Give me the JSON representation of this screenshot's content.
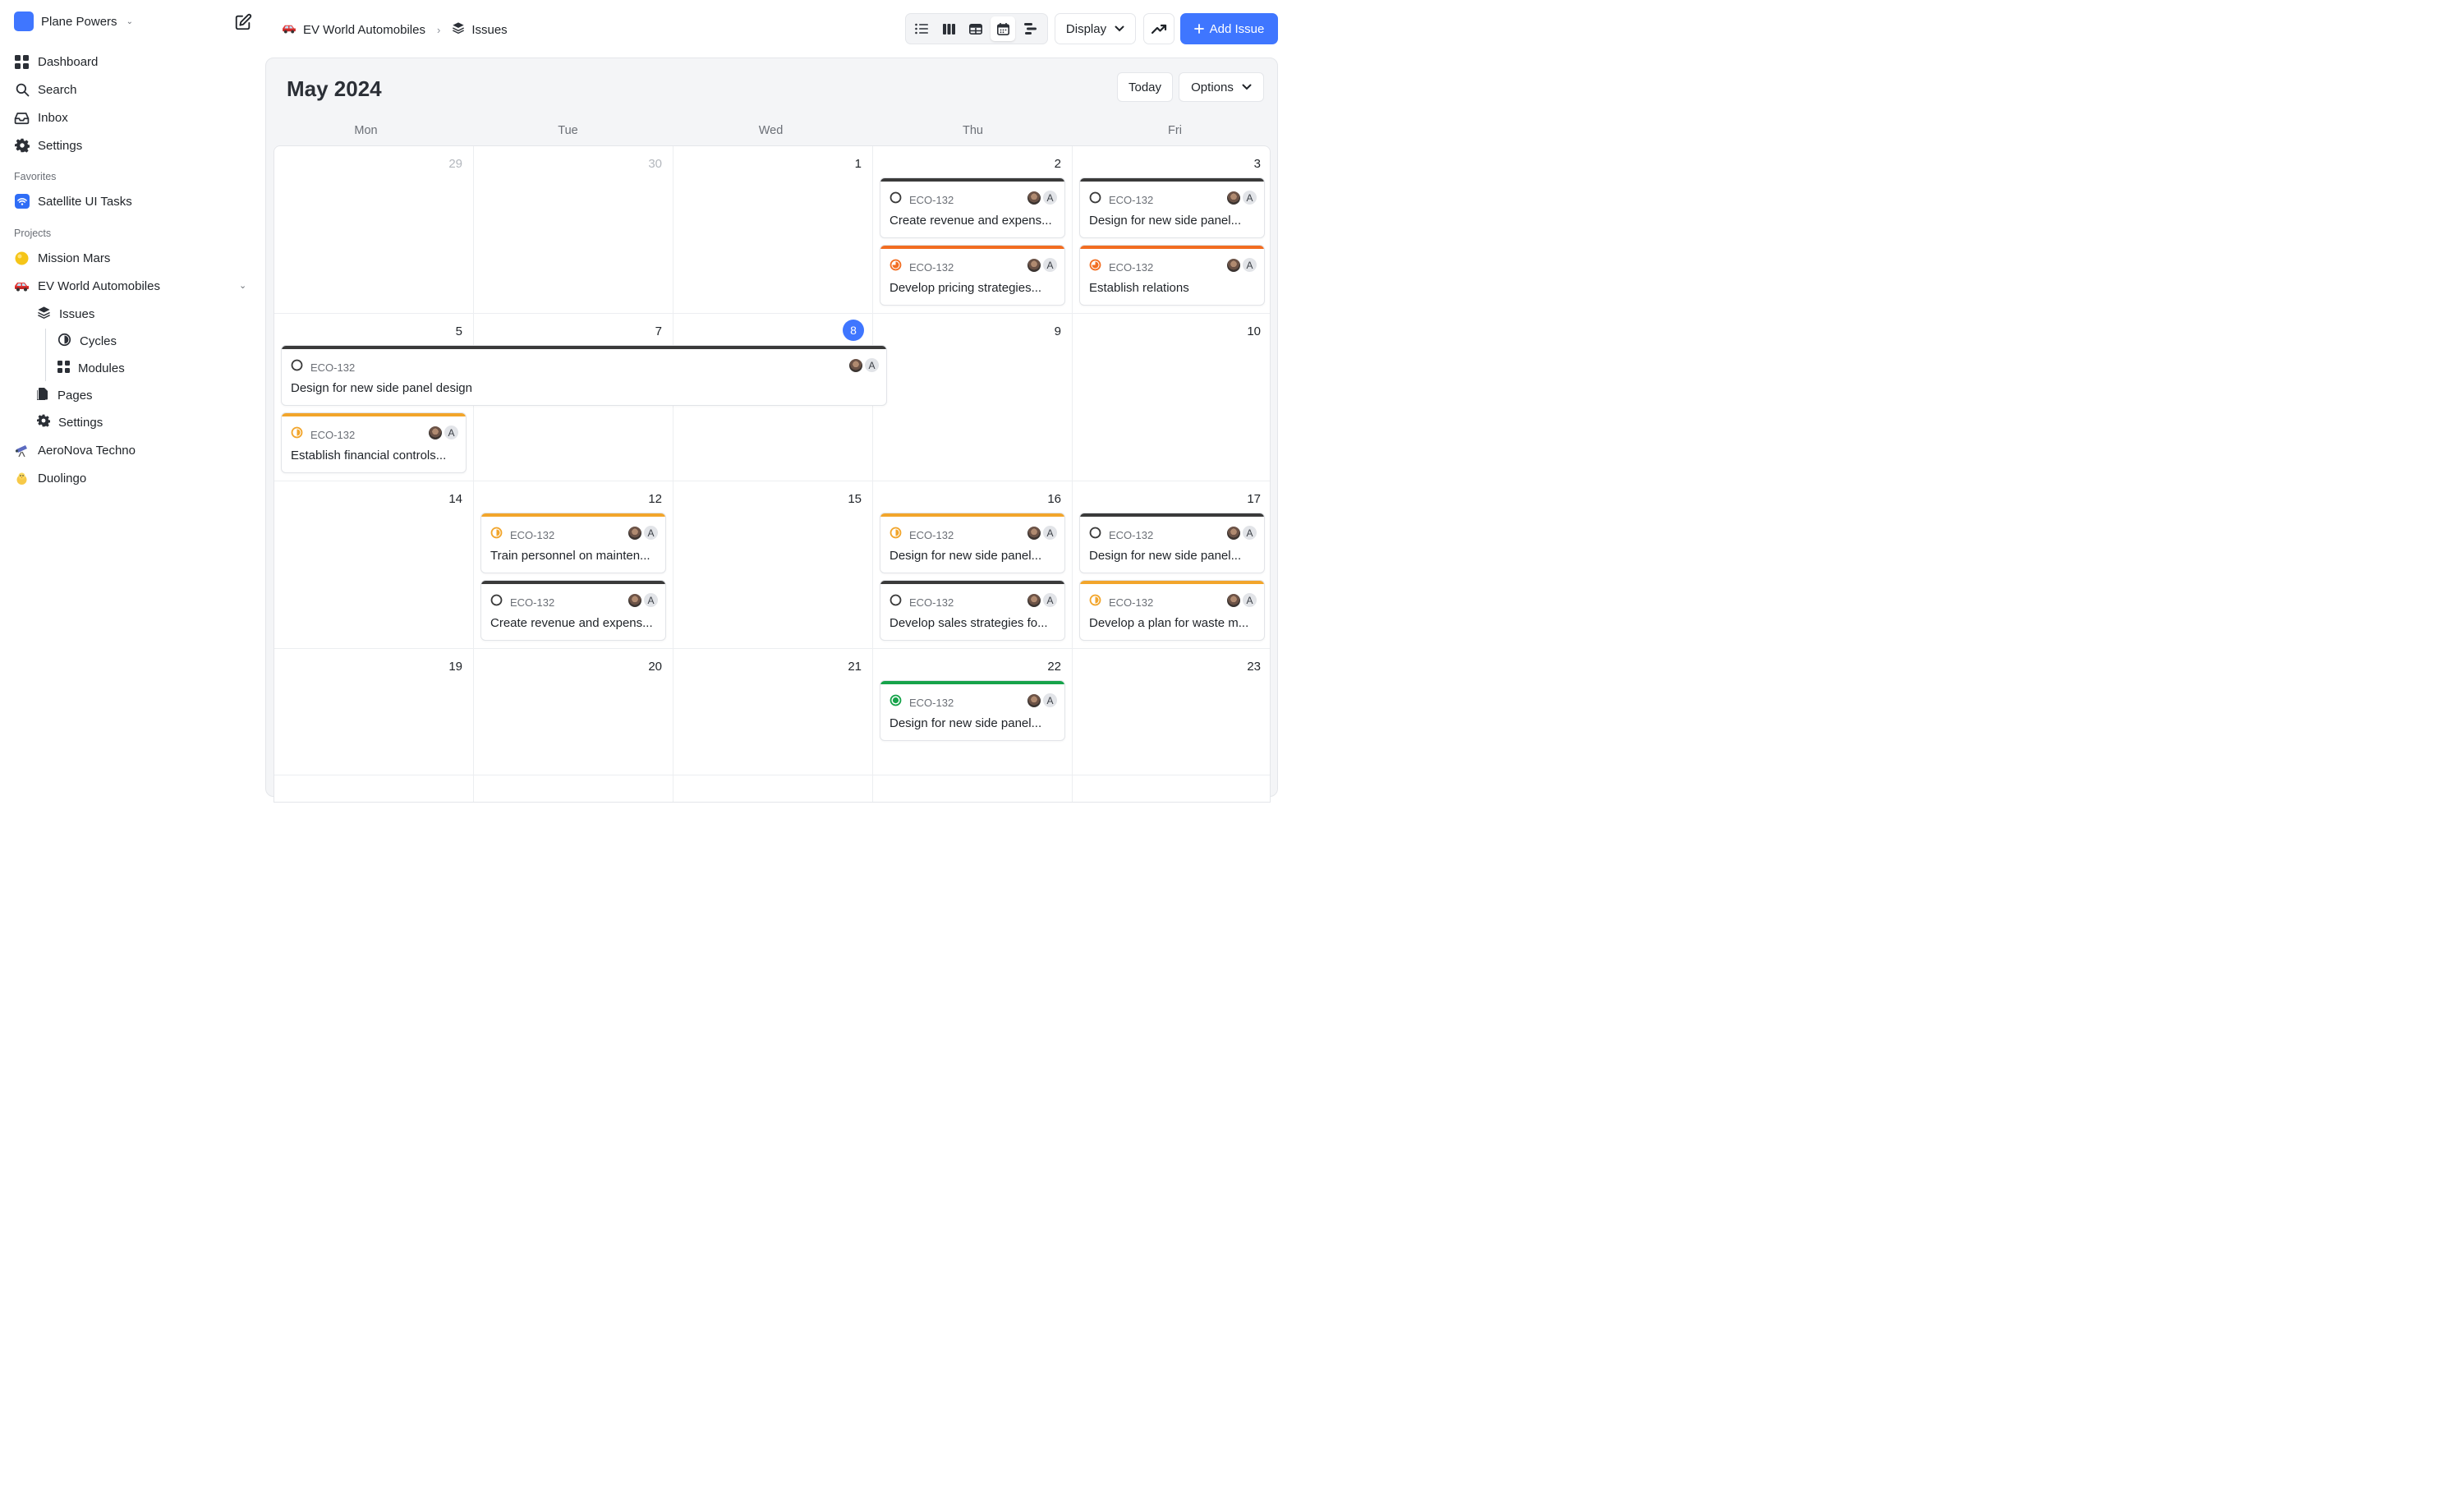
{
  "workspace": {
    "name": "Plane Powers"
  },
  "nav": [
    {
      "label": "Dashboard",
      "icon": "dashboard-icon"
    },
    {
      "label": "Search",
      "icon": "search-icon"
    },
    {
      "label": "Inbox",
      "icon": "inbox-icon"
    },
    {
      "label": "Settings",
      "icon": "gear-icon"
    }
  ],
  "favorites": {
    "heading": "Favorites",
    "items": [
      {
        "label": "Satellite UI Tasks",
        "icon": "wifi-icon"
      }
    ]
  },
  "projects": {
    "heading": "Projects",
    "mission_mars": "Mission Mars",
    "ev": "EV World Automobiles",
    "ev_sub": {
      "issues": "Issues",
      "cycles": "Cycles",
      "modules": "Modules",
      "pages": "Pages",
      "settings": "Settings"
    },
    "aeronova": "AeroNova Techno",
    "duolingo": "Duolingo"
  },
  "breadcrumb": {
    "project": "EV World Automobiles",
    "page": "Issues"
  },
  "header": {
    "display": "Display",
    "add_issue": "Add Issue"
  },
  "calendar": {
    "month": "May 2024",
    "today_label": "Today",
    "options_label": "Options",
    "weekdays": [
      "Mon",
      "Tue",
      "Wed",
      "Thu",
      "Fri"
    ],
    "weeks": [
      [
        "29",
        "30",
        "1",
        "2",
        "3"
      ],
      [
        "5",
        "7",
        "8",
        "9",
        "10"
      ],
      [
        "14",
        "12",
        "15",
        "16",
        "17"
      ],
      [
        "19",
        "20",
        "21",
        "22",
        "23"
      ]
    ],
    "today_date": "8",
    "issues": [
      {
        "id": "ECO-132",
        "title": "Create revenue and expens...",
        "state": "backlog"
      },
      {
        "id": "ECO-132",
        "title": "Develop pricing strategies...",
        "state": "in-progress"
      },
      {
        "id": "ECO-132",
        "title": "Design for new side panel...",
        "state": "backlog"
      },
      {
        "id": "ECO-132",
        "title": "Establish relations",
        "state": "in-progress"
      },
      {
        "id": "ECO-132",
        "title": "Design for new side panel design",
        "state": "backlog"
      },
      {
        "id": "ECO-132",
        "title": "Establish financial controls...",
        "state": "todo"
      },
      {
        "id": "ECO-132",
        "title": "Train personnel on mainten...",
        "state": "todo"
      },
      {
        "id": "ECO-132",
        "title": "Create revenue and expens...",
        "state": "backlog"
      },
      {
        "id": "ECO-132",
        "title": "Design for new side panel...",
        "state": "todo"
      },
      {
        "id": "ECO-132",
        "title": "Develop sales strategies fo...",
        "state": "backlog"
      },
      {
        "id": "ECO-132",
        "title": "Design for new side panel...",
        "state": "backlog"
      },
      {
        "id": "ECO-132",
        "title": "Develop a plan for waste m...",
        "state": "todo"
      },
      {
        "id": "ECO-132",
        "title": "Design for new side panel...",
        "state": "done"
      }
    ],
    "assignee_initial": "A"
  },
  "colors": {
    "accent": "#3f76ff",
    "backlog": "#3a3a3a",
    "in-progress": "#f26d21",
    "todo": "#f2a52b",
    "done": "#16a34a"
  }
}
